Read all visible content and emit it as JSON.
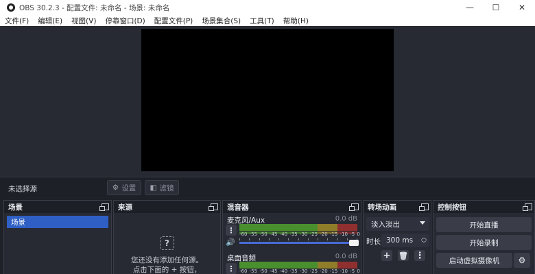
{
  "window": {
    "title": "OBS 30.2.3 - 配置文件: 未命名 - 场景: 未命名",
    "minimize": "—",
    "maximize": "☐",
    "close": "✕"
  },
  "menu": [
    "文件(F)",
    "编辑(E)",
    "视图(V)",
    "停靠窗口(D)",
    "配置文件(P)",
    "场景集合(S)",
    "工具(T)",
    "帮助(H)"
  ],
  "source_bar": {
    "no_source": "未选择源",
    "settings_label": "设置",
    "filters_label": "滤镜"
  },
  "docks": {
    "scenes": {
      "title": "场景",
      "items": [
        "场景"
      ]
    },
    "sources": {
      "title": "来源",
      "empty_line1": "您还没有添加任何源。",
      "empty_line2": "点击下面的 + 按钮，"
    },
    "mixer": {
      "title": "混音器",
      "channels": [
        {
          "name": "麦克风/Aux",
          "db": "0.0 dB"
        },
        {
          "name": "桌面音频",
          "db": "0.0 dB"
        }
      ],
      "ticks": [
        "-60",
        "-55",
        "-50",
        "-45",
        "-40",
        "-35",
        "-30",
        "-25",
        "-20",
        "-15",
        "-10",
        "-5",
        "0"
      ],
      "volume_level": 1.0
    },
    "transitions": {
      "title": "转场动画",
      "selected": "淡入淡出",
      "duration_label": "时长",
      "duration_value": "300 ms"
    },
    "controls": {
      "title": "控制按钮",
      "start_stream": "开始直播",
      "start_record": "开始录制",
      "start_vcam": "启动虚拟摄像机"
    }
  },
  "colors": {
    "accent": "#2f5fc4",
    "background": "#1f2129",
    "panel": "#272a33",
    "meter_green": "#4a8f2e",
    "meter_yellow": "#8f7d2a",
    "meter_red": "#8f2f2f"
  },
  "icons": {
    "settings": "gear-icon",
    "filters": "filter-icon",
    "undock": "undock-icon",
    "question": "question-icon",
    "volume": "speaker-icon",
    "add": "plus-icon",
    "remove": "trash-icon",
    "more": "kebab-icon"
  }
}
